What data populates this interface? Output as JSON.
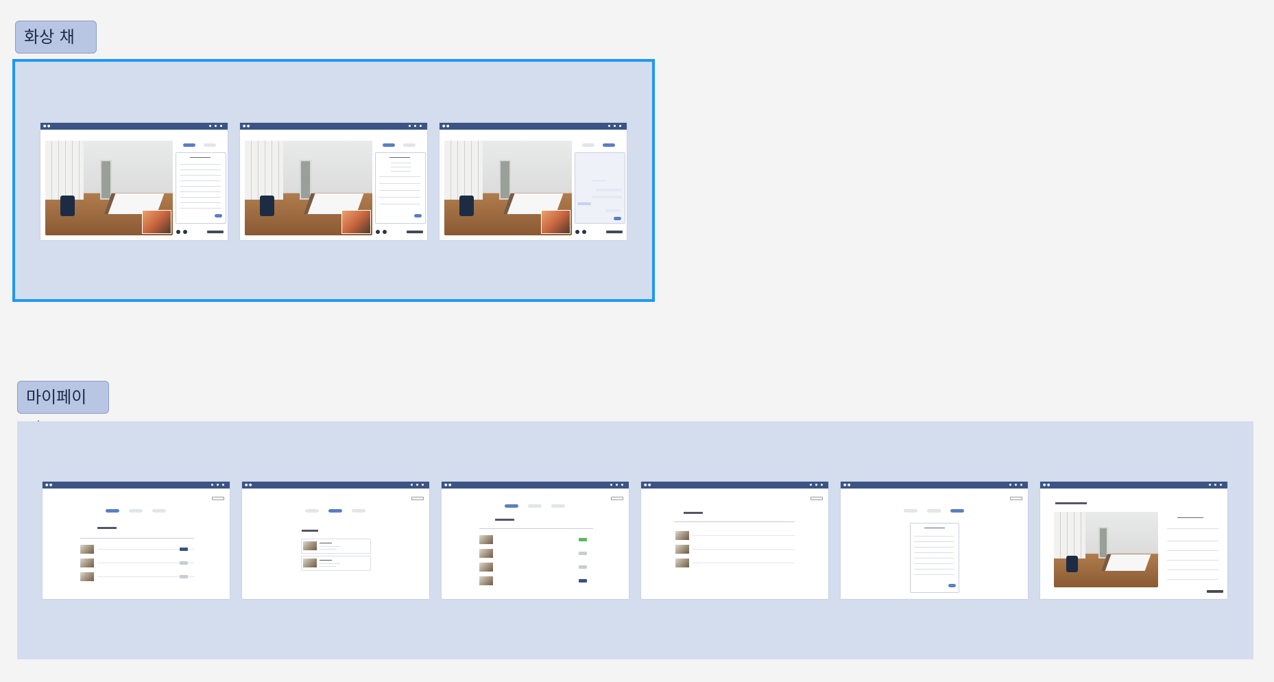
{
  "sections": [
    {
      "id": "video-chat",
      "label": "화상 채팅"
    },
    {
      "id": "mypage",
      "label": "마이페이지"
    }
  ],
  "colors": {
    "background": "#f4f4f4",
    "frame": "#d4ddee",
    "label_bg": "#b8c6e4",
    "selection": "#1f97f5",
    "app_bar": "#3b5484",
    "accent": "#5a7fc2"
  },
  "video_chat_screens": [
    {
      "name": "checklist-panel"
    },
    {
      "name": "checklist-detail-panel"
    },
    {
      "name": "chat-panel"
    }
  ],
  "mypage_screens": [
    {
      "name": "my-reservations"
    },
    {
      "name": "my-favorites"
    },
    {
      "name": "my-reservations-tab"
    },
    {
      "name": "my-reservations-list"
    },
    {
      "name": "checklist"
    },
    {
      "name": "recording-replay"
    }
  ]
}
